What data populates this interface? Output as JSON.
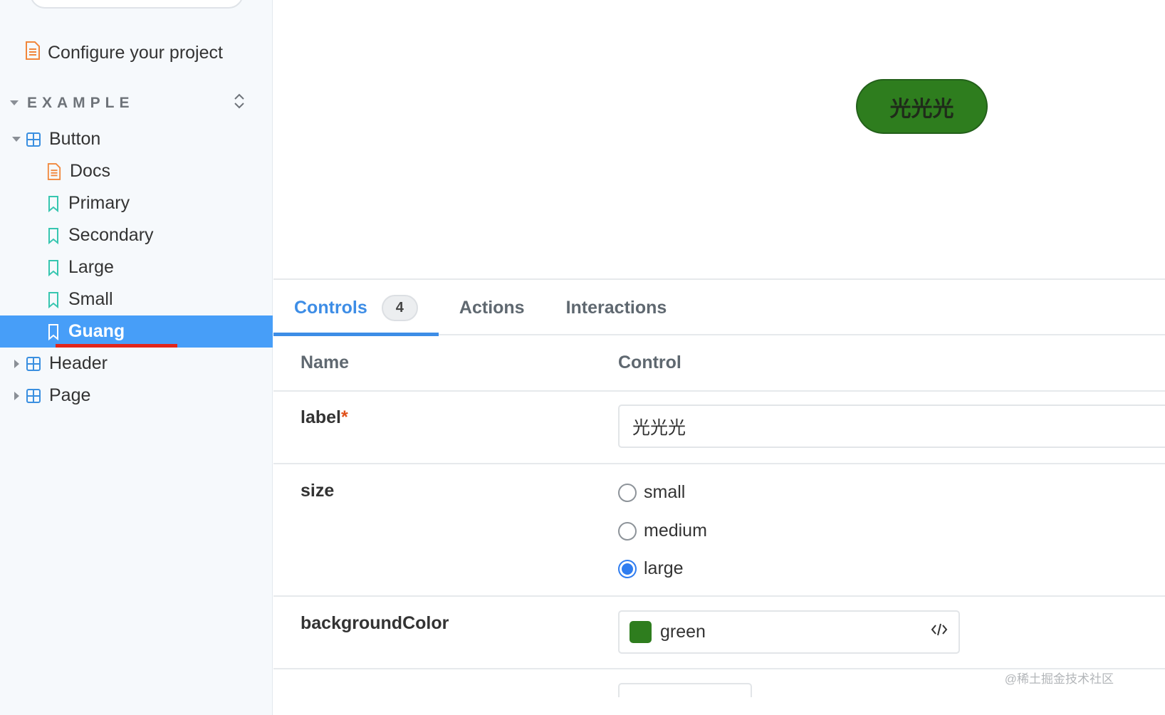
{
  "sidebar": {
    "top_doc": {
      "label": "Configure your project",
      "icon": "document-icon"
    },
    "section": {
      "title": "EXAMPLE",
      "expand_icon": "expand-collapse-icon"
    },
    "tree": [
      {
        "label": "Button",
        "type": "component",
        "expanded": true,
        "children": [
          {
            "label": "Docs",
            "type": "docs"
          },
          {
            "label": "Primary",
            "type": "story"
          },
          {
            "label": "Secondary",
            "type": "story"
          },
          {
            "label": "Large",
            "type": "story"
          },
          {
            "label": "Small",
            "type": "story"
          },
          {
            "label": "Guang",
            "type": "story",
            "selected": true
          }
        ]
      },
      {
        "label": "Header",
        "type": "component",
        "expanded": false
      },
      {
        "label": "Page",
        "type": "component",
        "expanded": false
      }
    ]
  },
  "preview": {
    "button_label": "光光光",
    "button_color": "#2e7d1e"
  },
  "tabs": [
    {
      "label": "Controls",
      "badge": "4",
      "active": true
    },
    {
      "label": "Actions",
      "active": false
    },
    {
      "label": "Interactions",
      "active": false
    }
  ],
  "controls": {
    "header_name": "Name",
    "header_control": "Control",
    "rows": {
      "label": {
        "name": "label",
        "required_mark": "*",
        "value": "光光光"
      },
      "size": {
        "name": "size",
        "options": [
          "small",
          "medium",
          "large"
        ],
        "selected": "large"
      },
      "backgroundColor": {
        "name": "backgroundColor",
        "value": "green",
        "swatch": "#2e7d1e"
      }
    }
  },
  "watermark": "@稀土掘金技术社区",
  "colors": {
    "accent": "#3d8de6",
    "selected_bg": "#479ef8",
    "sidebar_bg": "#f6f9fc",
    "story_icon": "#37c6b0",
    "component_icon": "#3a8fe0",
    "doc_icon": "#f1873b"
  }
}
